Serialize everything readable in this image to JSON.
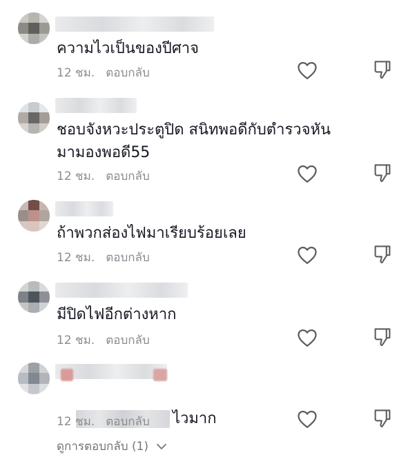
{
  "colors": {
    "text": "#161823",
    "meta": "#8a8b91",
    "icon": "#5b5c61",
    "link": "#73747a"
  },
  "comments": [
    {
      "text": "ความไวเป็นของปีศาจ",
      "time": "12 ชม.",
      "reply": "ตอบกลับ"
    },
    {
      "text": "ชอบจังหวะประตูปิด สนิทพอดีกับตำรวจหัน มามองพอดี55",
      "time": "12 ชม.",
      "reply": "ตอบกลับ"
    },
    {
      "text": "ถ้าพวกส่องไฟมาเรียบร้อยเลย",
      "time": "12 ชม.",
      "reply": "ตอบกลับ"
    },
    {
      "text": "มีปิดไฟอีกต่างหาก",
      "time": "12 ชม.",
      "reply": "ตอบกลับ"
    },
    {
      "text": "ไวมาก",
      "time": "12 ชม.",
      "reply": "ตอบกลับ"
    }
  ],
  "view_replies": {
    "label": "ดูการตอบกลับ (1)"
  },
  "icons": {
    "like": "heart-outline-icon",
    "dislike": "thumbs-down-outline-icon",
    "expand": "chevron-down-icon"
  }
}
